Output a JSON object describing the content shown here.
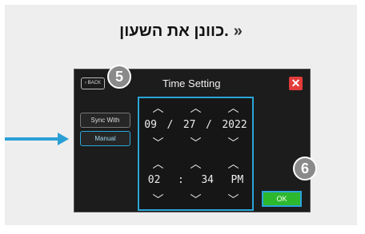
{
  "heading": {
    "text": "כוונן את השעון.",
    "arrow": "»"
  },
  "screen": {
    "back_label": "BACK",
    "title": "Time Setting",
    "close_symbol": "✕",
    "sync_label": "Sync With Phone",
    "manual_label": "Manual",
    "ok_label": "OK"
  },
  "date": {
    "month": "09",
    "sep1": "/",
    "day": "27",
    "sep2": "/",
    "year": "2022"
  },
  "time": {
    "hour": "02",
    "sep": ":",
    "minute": "34",
    "ampm": "PM"
  },
  "chevrons": {
    "up": "︿",
    "down": "﹀"
  },
  "badges": {
    "b5": "5",
    "b6": "6"
  },
  "colors": {
    "accent": "#2aa5d8",
    "ok_green": "#2eb82e",
    "close_red": "#e23b3b"
  }
}
